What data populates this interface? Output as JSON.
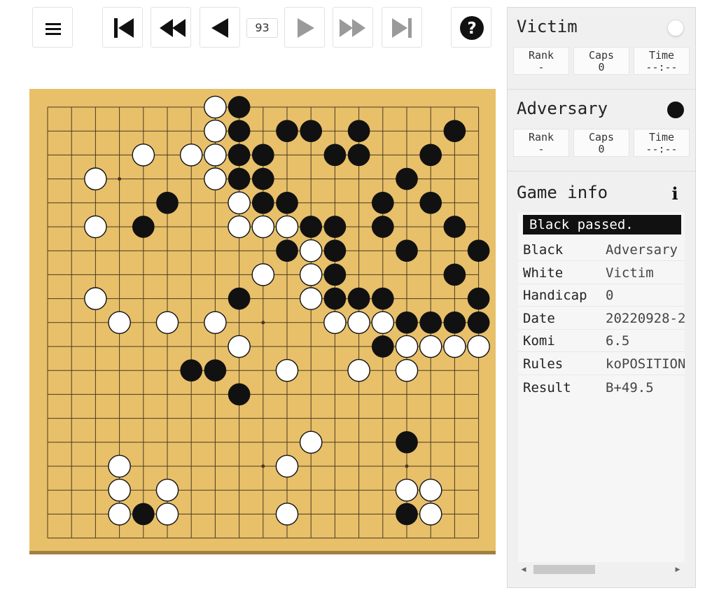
{
  "toolbar": {
    "menu_icon": "hamburger-menu-icon",
    "move_number": "93",
    "help_icon": "question-circle-icon",
    "buttons": [
      "first-move-icon",
      "back-many-icon",
      "back-one-icon",
      "forward-one-icon",
      "forward-many-icon",
      "last-move-icon"
    ]
  },
  "board": {
    "size": 19,
    "star_points": [
      [
        3,
        3
      ],
      [
        3,
        9
      ],
      [
        3,
        15
      ],
      [
        9,
        3
      ],
      [
        9,
        9
      ],
      [
        9,
        15
      ],
      [
        15,
        3
      ],
      [
        15,
        9
      ],
      [
        15,
        15
      ]
    ],
    "black_stones": [
      [
        8,
        0
      ],
      [
        8,
        1
      ],
      [
        10,
        1
      ],
      [
        11,
        1
      ],
      [
        13,
        1
      ],
      [
        17,
        1
      ],
      [
        8,
        2
      ],
      [
        9,
        2
      ],
      [
        12,
        2
      ],
      [
        13,
        2
      ],
      [
        16,
        2
      ],
      [
        8,
        3
      ],
      [
        9,
        3
      ],
      [
        15,
        3
      ],
      [
        5,
        4
      ],
      [
        9,
        4
      ],
      [
        10,
        4
      ],
      [
        14,
        4
      ],
      [
        16,
        4
      ],
      [
        4,
        5
      ],
      [
        11,
        5
      ],
      [
        12,
        5
      ],
      [
        14,
        5
      ],
      [
        17,
        5
      ],
      [
        10,
        6
      ],
      [
        12,
        6
      ],
      [
        15,
        6
      ],
      [
        18,
        6
      ],
      [
        12,
        7
      ],
      [
        17,
        7
      ],
      [
        8,
        8
      ],
      [
        12,
        8
      ],
      [
        13,
        8
      ],
      [
        14,
        8
      ],
      [
        18,
        8
      ],
      [
        15,
        9
      ],
      [
        16,
        9
      ],
      [
        17,
        9
      ],
      [
        18,
        9
      ],
      [
        14,
        10
      ],
      [
        6,
        11
      ],
      [
        7,
        11
      ],
      [
        8,
        12
      ],
      [
        15,
        14
      ],
      [
        4,
        17
      ],
      [
        15,
        17
      ]
    ],
    "white_stones": [
      [
        7,
        0
      ],
      [
        7,
        1
      ],
      [
        4,
        2
      ],
      [
        6,
        2
      ],
      [
        7,
        2
      ],
      [
        2,
        3
      ],
      [
        7,
        3
      ],
      [
        8,
        4
      ],
      [
        2,
        5
      ],
      [
        8,
        5
      ],
      [
        9,
        5
      ],
      [
        10,
        5
      ],
      [
        11,
        6
      ],
      [
        9,
        7
      ],
      [
        11,
        7
      ],
      [
        2,
        8
      ],
      [
        11,
        8
      ],
      [
        3,
        9
      ],
      [
        5,
        9
      ],
      [
        7,
        9
      ],
      [
        12,
        9
      ],
      [
        13,
        9
      ],
      [
        14,
        9
      ],
      [
        8,
        10
      ],
      [
        15,
        10
      ],
      [
        16,
        10
      ],
      [
        17,
        10
      ],
      [
        18,
        10
      ],
      [
        10,
        11
      ],
      [
        13,
        11
      ],
      [
        15,
        11
      ],
      [
        11,
        14
      ],
      [
        3,
        15
      ],
      [
        10,
        15
      ],
      [
        3,
        16
      ],
      [
        5,
        16
      ],
      [
        15,
        16
      ],
      [
        16,
        16
      ],
      [
        3,
        17
      ],
      [
        5,
        17
      ],
      [
        10,
        17
      ],
      [
        16,
        17
      ]
    ]
  },
  "players": {
    "white": {
      "name": "Victim",
      "stone_color": "#ffffff",
      "rank_label": "Rank",
      "rank": "-",
      "caps_label": "Caps",
      "caps": "0",
      "time_label": "Time",
      "time": "--:--"
    },
    "black": {
      "name": "Adversary",
      "stone_color": "#111111",
      "rank_label": "Rank",
      "rank": "-",
      "caps_label": "Caps",
      "caps": "0",
      "time_label": "Time",
      "time": "--:--"
    }
  },
  "game_info": {
    "title": "Game info",
    "info_icon": "info-icon",
    "message": "Black passed.",
    "rows": [
      {
        "key": "Black",
        "value": "Adversary"
      },
      {
        "key": "White",
        "value": "Victim"
      },
      {
        "key": "Handicap",
        "value": "0"
      },
      {
        "key": "Date",
        "value": "20220928-2"
      },
      {
        "key": "Komi",
        "value": "6.5"
      },
      {
        "key": "Rules",
        "value": "koPOSITIONAL"
      },
      {
        "key": "Result",
        "value": "B+49.5"
      }
    ]
  },
  "colors": {
    "board": "#e8c06a",
    "board_edge": "#a08040",
    "grid": "#4a3a20",
    "black_stone": "#111111",
    "white_stone": "#ffffff",
    "panel_bg": "#f0f0f0"
  }
}
